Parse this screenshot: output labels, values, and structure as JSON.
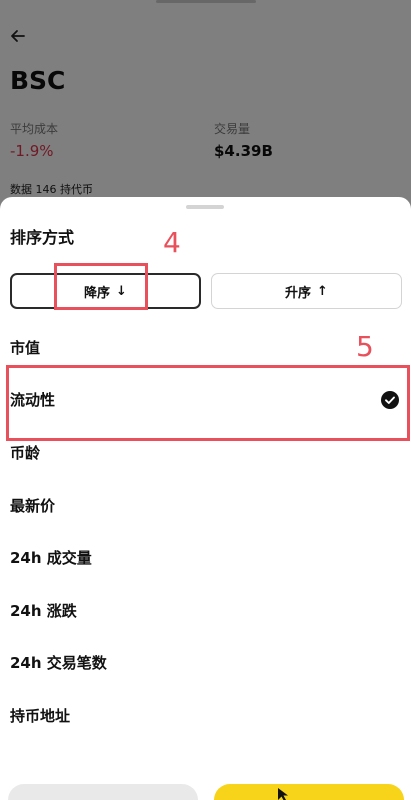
{
  "page": {
    "title": "BSC",
    "stats": [
      {
        "label": "平均成本",
        "value": "-1.9%"
      },
      {
        "label": "交易量",
        "value": "$4.39B"
      }
    ],
    "holders_text": "数据 146 持代币"
  },
  "sheet": {
    "title": "排序方式",
    "order_buttons": {
      "desc": {
        "label": "降序",
        "arrow": "↓"
      },
      "asc": {
        "label": "升序",
        "arrow": "↑"
      }
    },
    "options": [
      {
        "label": "市值",
        "selected": false
      },
      {
        "label": "流动性",
        "selected": true
      },
      {
        "label": "币龄",
        "selected": false
      },
      {
        "label": "最新价",
        "selected": false
      },
      {
        "label": "24h 成交量",
        "selected": false
      },
      {
        "label": "24h 涨跌",
        "selected": false
      },
      {
        "label": "24h 交易笔数",
        "selected": false
      },
      {
        "label": "持币地址",
        "selected": false
      }
    ]
  },
  "annotations": {
    "step_4": "4",
    "step_5": "5"
  },
  "colors": {
    "accent": "#f7d31a",
    "negative": "#e0344f",
    "annotation": "#e8505b"
  }
}
